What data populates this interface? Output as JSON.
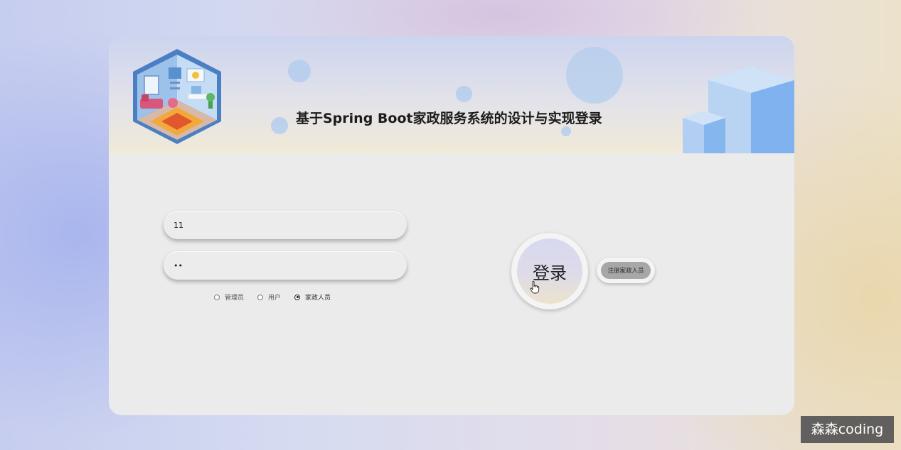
{
  "header": {
    "title": "基于Spring Boot家政服务系统的设计与实现登录"
  },
  "login_form": {
    "username_value": "11",
    "password_value": "11",
    "roles": [
      {
        "label": "管理员",
        "selected": false
      },
      {
        "label": "用户",
        "selected": false
      },
      {
        "label": "家政人员",
        "selected": true
      }
    ]
  },
  "actions": {
    "login_label": "登录",
    "register_label": "注册家政人员"
  },
  "watermark": {
    "text": "森森coding"
  },
  "colors": {
    "banner_bubble": "#b4cdee",
    "cube": "#7fb2ee",
    "card_background": "#ebebeb",
    "register_button": "#a7a7a7"
  },
  "icons": {
    "logo": "isometric-room-illustration",
    "cursor": "pointer-hand-cursor"
  }
}
